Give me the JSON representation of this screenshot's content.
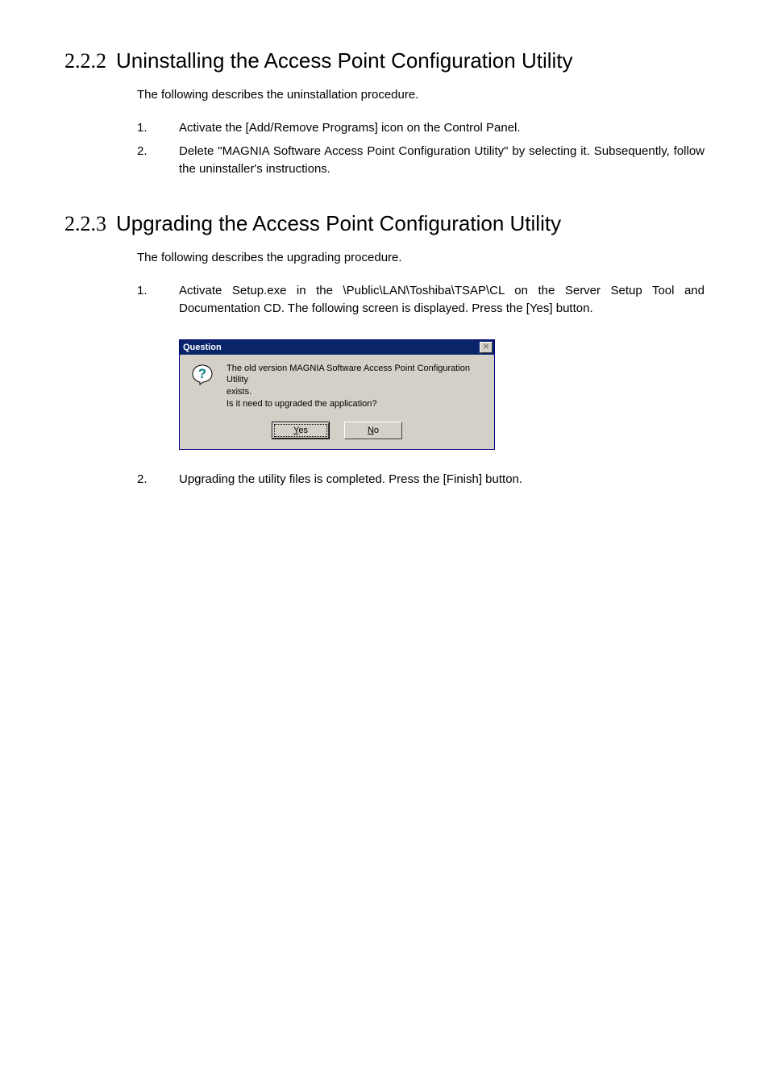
{
  "section1": {
    "number": "2.2.2",
    "title": "Uninstalling the Access Point Configuration Utility",
    "intro": "The following describes the uninstallation procedure.",
    "items": [
      {
        "num": "1.",
        "text": "Activate the [Add/Remove Programs] icon on the Control Panel."
      },
      {
        "num": "2.",
        "text": "Delete \"MAGNIA Software Access Point Configuration Utility\" by selecting it. Subsequently, follow the uninstaller's instructions."
      }
    ]
  },
  "section2": {
    "number": "2.2.3",
    "title": "Upgrading the Access Point Configuration Utility",
    "intro": "The following describes the upgrading procedure.",
    "items_before": [
      {
        "num": "1.",
        "text": "Activate Setup.exe in the \\Public\\LAN\\Toshiba\\TSAP\\CL on the Server Setup Tool and Documentation CD.   The following screen is displayed.   Press the [Yes] button."
      }
    ],
    "items_after": [
      {
        "num": "2.",
        "text": "Upgrading the utility files is completed.   Press the [Finish] button."
      }
    ]
  },
  "dialog": {
    "title": "Question",
    "line1": "The old version MAGNIA Software Access Point Configuration Utility",
    "line2": "exists.",
    "line3": "Is it need to upgraded the application?",
    "yes_mnemonic": "Y",
    "yes_rest": "es",
    "no_mnemonic": "N",
    "no_rest": "o"
  }
}
